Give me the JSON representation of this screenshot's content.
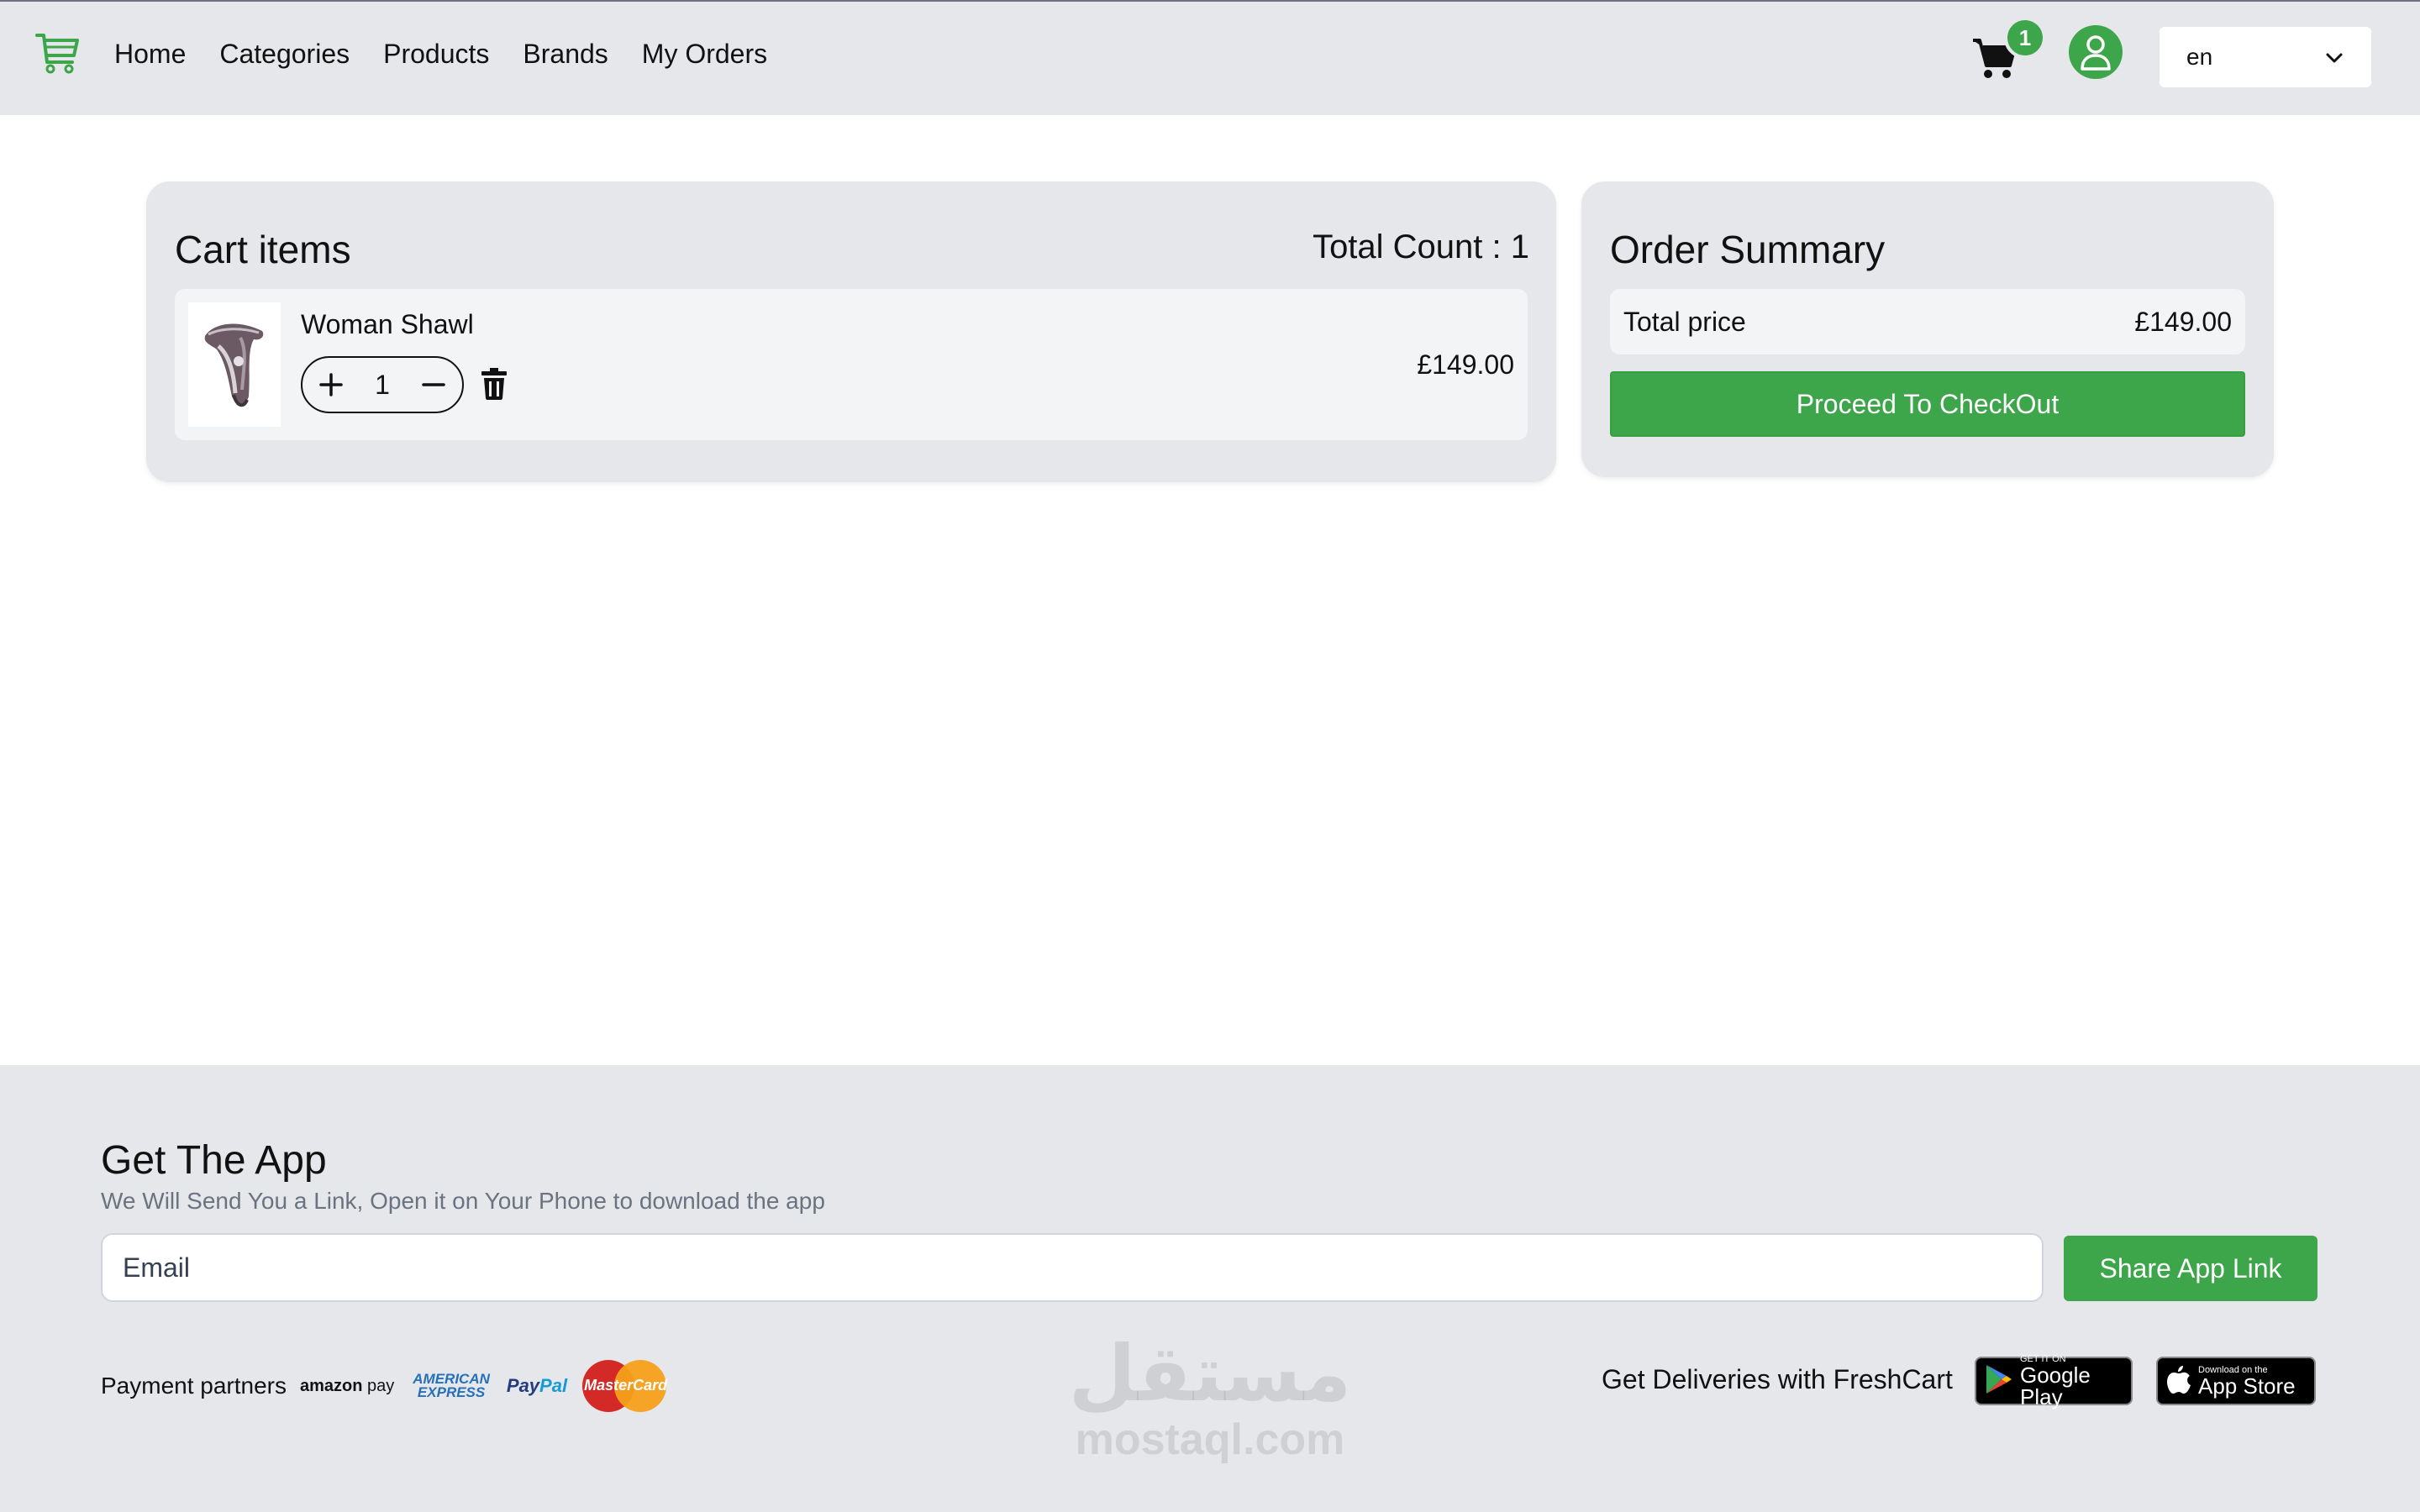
{
  "nav": {
    "links": [
      "Home",
      "Categories",
      "Products",
      "Brands",
      "My Orders"
    ],
    "cart_count": "1",
    "language": "en"
  },
  "cart": {
    "title": "Cart items",
    "total_count": "Total Count : 1",
    "items": [
      {
        "name": "Woman Shawl",
        "quantity": "1",
        "price": "£149.00"
      }
    ]
  },
  "summary": {
    "title": "Order Summary",
    "total_label": "Total price",
    "total_value": "£149.00",
    "checkout_label": "Proceed To CheckOut"
  },
  "footer": {
    "title": "Get The App",
    "subtitle": "We Will Send You a Link, Open it on Your Phone to download the app",
    "email_placeholder": "Email",
    "share_label": "Share App Link",
    "partners_label": "Payment partners",
    "partners": {
      "amazon": "amazon",
      "amazon_pay": "pay",
      "amex_line1": "AMERICAN",
      "amex_line2": "EXPRESS",
      "paypal_1": "Pay",
      "paypal_2": "Pal",
      "mastercard": "MasterCard"
    },
    "deliveries_label": "Get Deliveries with FreshCart",
    "google_play_small": "GET IT ON",
    "google_play_big": "Google Play",
    "app_store_small": "Download on the",
    "app_store_big": "App Store"
  },
  "watermark": {
    "glyph": "مستقل",
    "url": "mostaql.com"
  },
  "colors": {
    "accent": "#3da54a",
    "surface": "#e5e7eb",
    "row": "#f3f4f6"
  }
}
